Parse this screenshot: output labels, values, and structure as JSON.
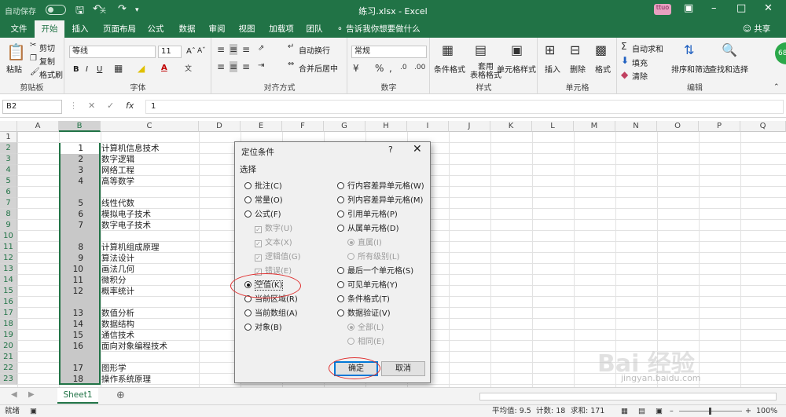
{
  "titlebar": {
    "autosave": "自动保存",
    "toggle_state": "关",
    "title": "练习.xlsx  -  Excel",
    "user": "ttuo"
  },
  "tabs": [
    "文件",
    "开始",
    "插入",
    "页面布局",
    "公式",
    "数据",
    "审阅",
    "视图",
    "加载项",
    "团队"
  ],
  "active_tab": "开始",
  "tell_me": "告诉我你想要做什么",
  "share": "共享",
  "ribbon": {
    "clipboard": {
      "paste": "粘贴",
      "cut": "剪切",
      "copy": "复制",
      "format_painter": "格式刷",
      "label": "剪贴板"
    },
    "font": {
      "name": "等线",
      "size": "11",
      "label": "字体"
    },
    "alignment": {
      "wrap": "自动换行",
      "merge": "合并后居中",
      "label": "对齐方式"
    },
    "number": {
      "format": "常规",
      "label": "数字"
    },
    "styles": {
      "cond": "条件格式",
      "table": "套用\n表格格式",
      "cell": "单元格样式",
      "label": "样式"
    },
    "cells": {
      "insert": "插入",
      "delete": "删除",
      "format": "格式",
      "label": "单元格"
    },
    "editing": {
      "autosum": "自动求和",
      "fill": "填充",
      "clear": "清除",
      "sort": "排序和筛选",
      "find": "查找和选择",
      "label": "编辑"
    },
    "badge": "68"
  },
  "formula_bar": {
    "name_box": "B2",
    "value": "1"
  },
  "columns": [
    "A",
    "B",
    "C",
    "D",
    "E",
    "F",
    "G",
    "H",
    "I",
    "J",
    "K",
    "L",
    "M",
    "N",
    "O",
    "P",
    "Q"
  ],
  "rows": [
    "1",
    "2",
    "3",
    "4",
    "5",
    "6",
    "7",
    "8",
    "9",
    "10",
    "11",
    "12",
    "13",
    "14",
    "15",
    "16",
    "17",
    "18",
    "19",
    "20",
    "21",
    "22",
    "23"
  ],
  "cells_b": [
    "",
    "1",
    "2",
    "3",
    "4",
    "",
    "5",
    "6",
    "7",
    "",
    "8",
    "9",
    "10",
    "11",
    "12",
    "",
    "13",
    "14",
    "15",
    "16",
    "",
    "17",
    "18"
  ],
  "cells_c": [
    "",
    "计算机信息技术",
    "数字逻辑",
    "网络工程",
    "高等数学",
    "",
    "线性代数",
    "模拟电子技术",
    "数字电子技术",
    "",
    "计算机组成原理",
    "算法设计",
    "画法几何",
    "微积分",
    "概率统计",
    "",
    "数值分析",
    "数据结构",
    "通信技术",
    "面向对象编程技术",
    "",
    "图形学",
    "操作系统原理"
  ],
  "dialog": {
    "title": "定位条件",
    "help": "?",
    "section": "选择",
    "left": [
      "批注(C)",
      "常量(O)",
      "公式(F)",
      "数字(U)",
      "文本(X)",
      "逻辑值(G)",
      "错误(E)",
      "空值(K)",
      "当前区域(R)",
      "当前数组(A)",
      "对象(B)"
    ],
    "right": [
      "行内容差异单元格(W)",
      "列内容差异单元格(M)",
      "引用单元格(P)",
      "从属单元格(D)",
      "直属(I)",
      "所有级别(L)",
      "最后一个单元格(S)",
      "可见单元格(Y)",
      "条件格式(T)",
      "数据验证(V)",
      "全部(L)",
      "相同(E)"
    ],
    "ok": "确定",
    "cancel": "取消"
  },
  "sheet_tab": "Sheet1",
  "status": {
    "ready": "就绪",
    "average": "平均值: 9.5",
    "count": "计数: 18",
    "sum": "求和: 171",
    "zoom": "100%"
  },
  "watermark": "Bai 经验",
  "watermark_url": "jingyan.baidu.com",
  "colors": {
    "excel_green": "#217346",
    "selection_gray": "#c8c8c8",
    "annotation_red": "#e03030"
  }
}
